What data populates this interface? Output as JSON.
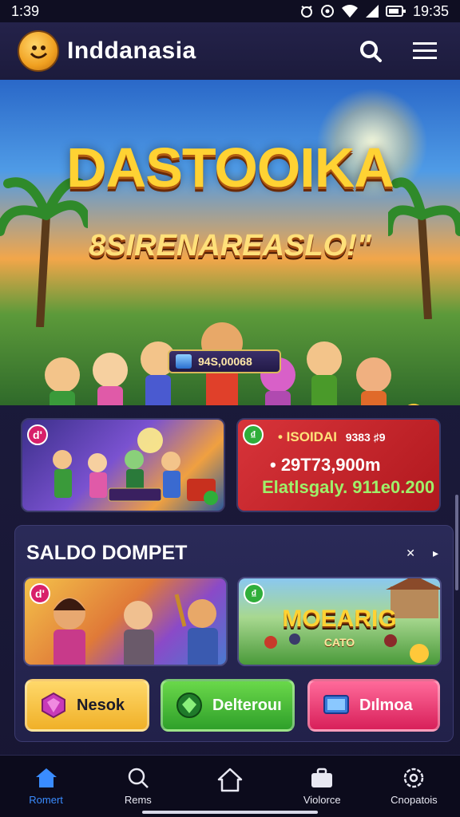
{
  "status_bar": {
    "time_left": "1:39",
    "time_right": "19:35"
  },
  "app_bar": {
    "title": "Inddanasia"
  },
  "hero": {
    "title": "DASTOOIKA",
    "subtitle": "8SIRENAREASLO!\"",
    "pill_value": "94S,00068",
    "carousel_dots": 3
  },
  "promo_cards": {
    "left_badge": "d'",
    "right_badge": "₫",
    "right_line1": "• ISOIDAI",
    "right_line2": "• 29T73,900m",
    "right_line3": "Elatlsgaly. 911e0.200",
    "right_line1_extra": "9383 ♯9"
  },
  "panel": {
    "title": "SALDO DOMPET",
    "nav_prev": "✕",
    "nav_next": "▸",
    "game_left_badge": "d'",
    "game_right_badge": "₫",
    "game_right_logo": "MOEARIG",
    "game_right_logo_sub": "CATO",
    "buttons": [
      {
        "label": "Nesok"
      },
      {
        "label": "Delterouı"
      },
      {
        "label": "Dılmoa"
      }
    ]
  },
  "bottom_nav": [
    {
      "label": "Romert",
      "icon": "home-filled-icon",
      "active": true
    },
    {
      "label": "Rems",
      "icon": "search-icon",
      "active": false
    },
    {
      "label": "",
      "icon": "home-outline-icon",
      "active": false
    },
    {
      "label": "Violorce",
      "icon": "briefcase-icon",
      "active": false
    },
    {
      "label": "Cnopatois",
      "icon": "gear-icon",
      "active": false
    }
  ],
  "colors": {
    "accent": "#3a8cff",
    "background": "#1b1a3a",
    "promo_red": "#d8343a"
  }
}
